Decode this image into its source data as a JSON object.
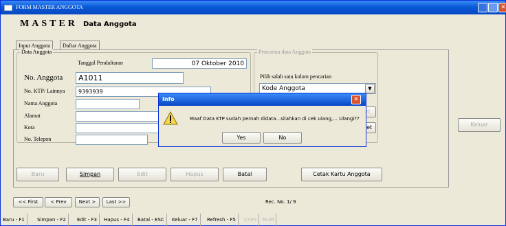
{
  "window": {
    "title": "FORM MASTER ANGGOTA"
  },
  "header": {
    "title": "MASTER",
    "subtitle": "Data Anggota"
  },
  "tabs": [
    {
      "label": "Input Anggota"
    },
    {
      "label": "Daftar Anggota"
    }
  ],
  "data_anggota": {
    "group_title": "Data Anggota",
    "tgl_label": "Tanggal Pendaftaran",
    "tgl_value": "07 Oktober 2010",
    "no_anggota_label": "No. Anggota",
    "no_anggota_value": "A1011",
    "ktp_label": "No. KTP/ Lainnya",
    "ktp_value": "9393939",
    "nama_label": "Nama Anggota",
    "alamat_label": "Alamat",
    "kota_label": "Kota",
    "telepon_label": "No. Telepon"
  },
  "pencarian": {
    "group_title": "Pencarian data Anggota",
    "prompt": "Pilih salah satu kolom pencarian",
    "selected": "Kode Anggota",
    "cari_label": "Cari",
    "reset_label": "Reset"
  },
  "keluar_label": "Keluar",
  "actions": {
    "baru": "Baru",
    "simpan": "Simpan",
    "edit": "Edit",
    "hapus": "Hapus",
    "batal": "Batal",
    "cetak": "Cetak Kartu Anggota"
  },
  "nav": {
    "first": "<< First",
    "prev": "< Prev",
    "next": "Next >",
    "last": "Last >>",
    "rec": "Rec. No. 1/ 9"
  },
  "statusbar": [
    "Baru - F1",
    "Simpan - F2",
    "Edit - F3",
    "Hapus - F4",
    "Batal - ESC",
    "Keluar - F7",
    "Refresh - F5",
    "CAPS",
    "NUM"
  ],
  "dialog": {
    "title": "Info",
    "message": "Maaf Data KTP sudah pernah didata...silahkan di cek ulang,... Ulangi??",
    "yes": "Yes",
    "no": "No"
  }
}
